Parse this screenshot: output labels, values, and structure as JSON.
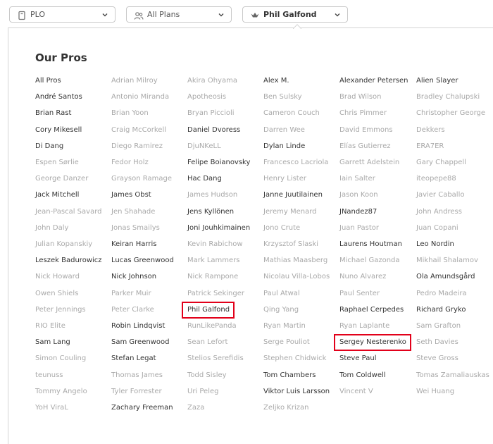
{
  "filters": {
    "game": {
      "label": "PLO"
    },
    "plans": {
      "label": "All Plans"
    },
    "pro": {
      "label": "Phil Galfond"
    }
  },
  "panel": {
    "title": "Our Pros"
  },
  "pros": [
    [
      {
        "name": "All Pros",
        "active": true
      },
      {
        "name": "André Santos",
        "active": true
      },
      {
        "name": "Brian Rast",
        "active": true
      },
      {
        "name": "Cory Mikesell",
        "active": true
      },
      {
        "name": "Di Dang",
        "active": true
      },
      {
        "name": "Espen Sørlie",
        "active": false
      },
      {
        "name": "George Danzer",
        "active": false
      },
      {
        "name": "Jack Mitchell",
        "active": true
      },
      {
        "name": "Jean-Pascal Savard",
        "active": false
      },
      {
        "name": "John Daly",
        "active": false
      },
      {
        "name": "Julian Kopanskiy",
        "active": false
      },
      {
        "name": "Leszek Badurowicz",
        "active": true
      },
      {
        "name": "Nick Howard",
        "active": false
      },
      {
        "name": "Owen Shiels",
        "active": false
      },
      {
        "name": "Peter Jennings",
        "active": false
      },
      {
        "name": "RIO Elite",
        "active": false
      },
      {
        "name": "Sam Lang",
        "active": true
      },
      {
        "name": "Simon Couling",
        "active": false
      },
      {
        "name": "teunuss",
        "active": false
      },
      {
        "name": "Tommy Angelo",
        "active": false
      },
      {
        "name": "YoH ViraL",
        "active": false
      }
    ],
    [
      {
        "name": "Adrian Milroy",
        "active": false
      },
      {
        "name": "Antonio Miranda",
        "active": false
      },
      {
        "name": "Brian Yoon",
        "active": false
      },
      {
        "name": "Craig McCorkell",
        "active": false
      },
      {
        "name": "Diego Ramirez",
        "active": false
      },
      {
        "name": "Fedor Holz",
        "active": false
      },
      {
        "name": "Grayson Ramage",
        "active": false
      },
      {
        "name": "James Obst",
        "active": true
      },
      {
        "name": "Jen Shahade",
        "active": false
      },
      {
        "name": "Jonas Smailys",
        "active": false
      },
      {
        "name": "Keiran Harris",
        "active": true
      },
      {
        "name": "Lucas Greenwood",
        "active": true
      },
      {
        "name": "Nick Johnson",
        "active": true
      },
      {
        "name": "Parker Muir",
        "active": false
      },
      {
        "name": "Peter Clarke",
        "active": false
      },
      {
        "name": "Robin Lindqvist",
        "active": true
      },
      {
        "name": "Sam Greenwood",
        "active": true
      },
      {
        "name": "Stefan Legat",
        "active": true
      },
      {
        "name": "Thomas James",
        "active": false
      },
      {
        "name": "Tyler Forrester",
        "active": false
      },
      {
        "name": "Zachary Freeman",
        "active": true
      }
    ],
    [
      {
        "name": "Akira Ohyama",
        "active": false
      },
      {
        "name": "Apotheosis",
        "active": false
      },
      {
        "name": "Bryan Piccioli",
        "active": false
      },
      {
        "name": "Daniel Dvoress",
        "active": true
      },
      {
        "name": "DjuNKeLL",
        "active": false
      },
      {
        "name": "Felipe Boianovsky",
        "active": true
      },
      {
        "name": "Hac Dang",
        "active": true
      },
      {
        "name": "James Hudson",
        "active": false
      },
      {
        "name": "Jens Kyllönen",
        "active": true
      },
      {
        "name": "Joni Jouhkimainen",
        "active": true
      },
      {
        "name": "Kevin Rabichow",
        "active": false
      },
      {
        "name": "Mark Lammers",
        "active": false
      },
      {
        "name": "Nick Rampone",
        "active": false
      },
      {
        "name": "Patrick Sekinger",
        "active": false
      },
      {
        "name": "Phil Galfond",
        "active": true,
        "highlight": true
      },
      {
        "name": "RunLikePanda",
        "active": false
      },
      {
        "name": "Sean Lefort",
        "active": false
      },
      {
        "name": "Stelios Serefidis",
        "active": false
      },
      {
        "name": "Todd Sisley",
        "active": false
      },
      {
        "name": "Uri Peleg",
        "active": false
      },
      {
        "name": "Zaza",
        "active": false
      }
    ],
    [
      {
        "name": "Alex M.",
        "active": true
      },
      {
        "name": "Ben Sulsky",
        "active": false
      },
      {
        "name": "Cameron Couch",
        "active": false
      },
      {
        "name": "Darren Wee",
        "active": false
      },
      {
        "name": "Dylan Linde",
        "active": true
      },
      {
        "name": "Francesco Lacriola",
        "active": false
      },
      {
        "name": "Henry Lister",
        "active": false
      },
      {
        "name": "Janne Juutilainen",
        "active": true
      },
      {
        "name": "Jeremy Menard",
        "active": false
      },
      {
        "name": "Jono Crute",
        "active": false
      },
      {
        "name": "Krzysztof Slaski",
        "active": false
      },
      {
        "name": "Mathias Maasberg",
        "active": false
      },
      {
        "name": "Nicolau Villa-Lobos",
        "active": false
      },
      {
        "name": "Paul Atwal",
        "active": false
      },
      {
        "name": "Qing Yang",
        "active": false
      },
      {
        "name": "Ryan Martin",
        "active": false
      },
      {
        "name": "Serge Pouliot",
        "active": false
      },
      {
        "name": "Stephen Chidwick",
        "active": false
      },
      {
        "name": "Tom Chambers",
        "active": true
      },
      {
        "name": "Viktor Luis Larsson",
        "active": true
      },
      {
        "name": "Zeljko Krizan",
        "active": false
      }
    ],
    [
      {
        "name": "Alexander Petersen",
        "active": true
      },
      {
        "name": "Brad Wilson",
        "active": false
      },
      {
        "name": "Chris Pimmer",
        "active": false
      },
      {
        "name": "David Emmons",
        "active": false
      },
      {
        "name": "Elías Gutierrez",
        "active": false
      },
      {
        "name": "Garrett Adelstein",
        "active": false
      },
      {
        "name": "Iain Salter",
        "active": false
      },
      {
        "name": "Jason Koon",
        "active": false
      },
      {
        "name": "JNandez87",
        "active": true
      },
      {
        "name": "Juan Pastor",
        "active": false
      },
      {
        "name": "Laurens Houtman",
        "active": true
      },
      {
        "name": "Michael Gazonda",
        "active": false
      },
      {
        "name": "Nuno Alvarez",
        "active": false
      },
      {
        "name": "Paul Senter",
        "active": false
      },
      {
        "name": "Raphael Cerpedes",
        "active": true
      },
      {
        "name": "Ryan Laplante",
        "active": false
      },
      {
        "name": "Sergey Nesterenko",
        "active": true,
        "highlight": true
      },
      {
        "name": "Steve Paul",
        "active": true
      },
      {
        "name": "Tom Coldwell",
        "active": true
      },
      {
        "name": "Vincent V",
        "active": false
      }
    ],
    [
      {
        "name": "Alien Slayer",
        "active": true
      },
      {
        "name": "Bradley Chalupski",
        "active": false
      },
      {
        "name": "Christopher George",
        "active": false
      },
      {
        "name": "Dekkers",
        "active": false
      },
      {
        "name": "ERA7ER",
        "active": false
      },
      {
        "name": "Gary Chappell",
        "active": false
      },
      {
        "name": "iteopepe88",
        "active": false
      },
      {
        "name": "Javier Caballo",
        "active": false
      },
      {
        "name": "John Andress",
        "active": false
      },
      {
        "name": "Juan Copani",
        "active": false
      },
      {
        "name": "Leo Nordin",
        "active": true
      },
      {
        "name": "Mikhail Shalamov",
        "active": false
      },
      {
        "name": "Ola Amundsgård",
        "active": true
      },
      {
        "name": "Pedro Madeira",
        "active": false
      },
      {
        "name": "Richard Gryko",
        "active": true
      },
      {
        "name": "Sam Grafton",
        "active": false
      },
      {
        "name": "Seth Davies",
        "active": false
      },
      {
        "name": "Steve Gross",
        "active": false
      },
      {
        "name": "Tomas Zamaliauskas",
        "active": false
      },
      {
        "name": "Wei Huang",
        "active": false
      }
    ]
  ]
}
